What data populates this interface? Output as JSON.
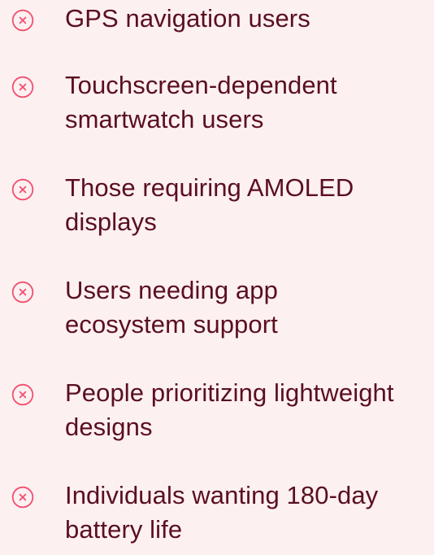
{
  "accent_color": "#f0506e",
  "text_color": "#5a0f1f",
  "background_color": "#fdf0f1",
  "icon_name": "x-circle-icon",
  "items": [
    {
      "label": "GPS navigation users"
    },
    {
      "label": "Touchscreen-dependent\nsmartwatch users"
    },
    {
      "label": "Those requiring AMOLED\ndisplays"
    },
    {
      "label": "Users needing app\necosystem support"
    },
    {
      "label": "People prioritizing lightweight\ndesigns"
    },
    {
      "label": "Individuals wanting 180-day\nbattery life"
    }
  ]
}
